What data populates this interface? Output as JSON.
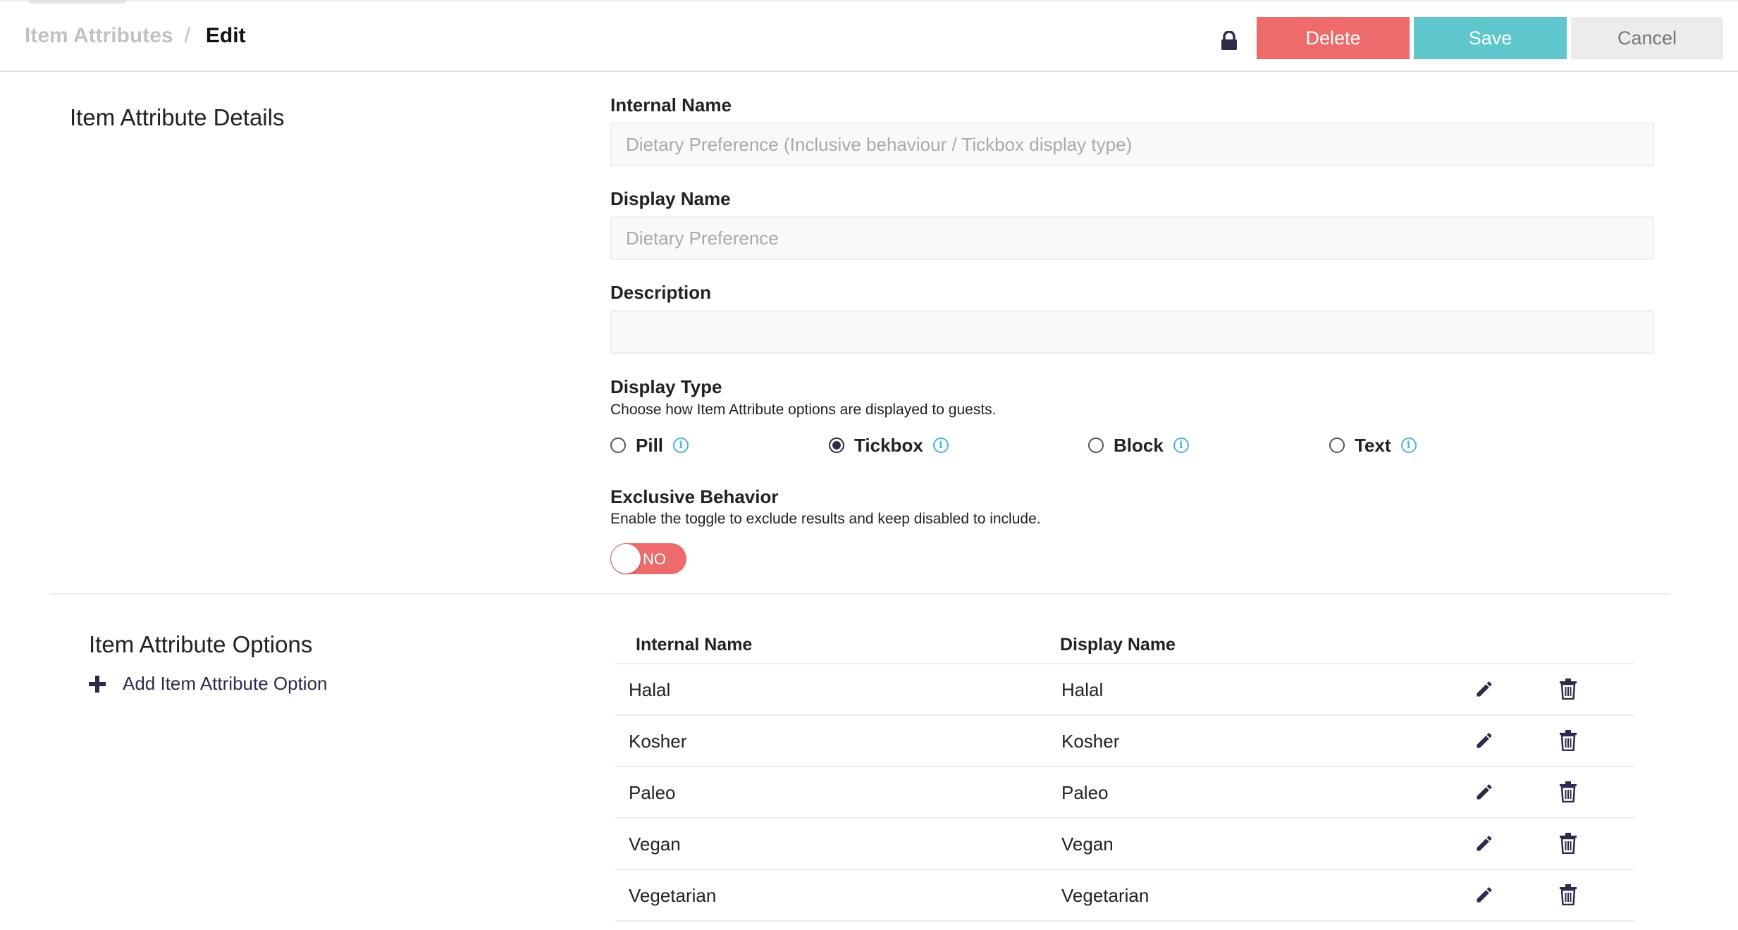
{
  "header": {
    "breadcrumb_parent": "Item Attributes",
    "breadcrumb_separator": "/",
    "breadcrumb_current": "Edit",
    "delete_label": "Delete",
    "save_label": "Save",
    "cancel_label": "Cancel"
  },
  "details": {
    "section_title": "Item Attribute Details",
    "internal_name_label": "Internal Name",
    "internal_name_placeholder": "Dietary Preference (Inclusive behaviour / Tickbox display type)",
    "display_name_label": "Display Name",
    "display_name_placeholder": "Dietary Preference",
    "description_label": "Description",
    "description_value": "",
    "display_type_label": "Display Type",
    "display_type_help": "Choose how Item Attribute options are displayed to guests.",
    "display_type_options": [
      "Pill",
      "Tickbox",
      "Block",
      "Text"
    ],
    "display_type_selected": "Tickbox",
    "exclusive_label": "Exclusive Behavior",
    "exclusive_help": "Enable the toggle to exclude results and keep disabled to include.",
    "exclusive_toggle_label": "NO"
  },
  "options": {
    "section_title": "Item Attribute Options",
    "add_label": "Add Item Attribute Option",
    "columns": [
      "Internal Name",
      "Display Name"
    ],
    "rows": [
      {
        "internal": "Halal",
        "display": "Halal"
      },
      {
        "internal": "Kosher",
        "display": "Kosher"
      },
      {
        "internal": "Paleo",
        "display": "Paleo"
      },
      {
        "internal": "Vegan",
        "display": "Vegan"
      },
      {
        "internal": "Vegetarian",
        "display": "Vegetarian"
      }
    ]
  },
  "colors": {
    "delete": "#ee6b6b",
    "save": "#5fc7cc",
    "cancel": "#ececec",
    "accent_dark": "#2d2a4a",
    "info": "#49b4e0"
  },
  "icons": [
    "lock-icon",
    "info-icon",
    "plus-icon",
    "pencil-icon",
    "trash-icon"
  ]
}
